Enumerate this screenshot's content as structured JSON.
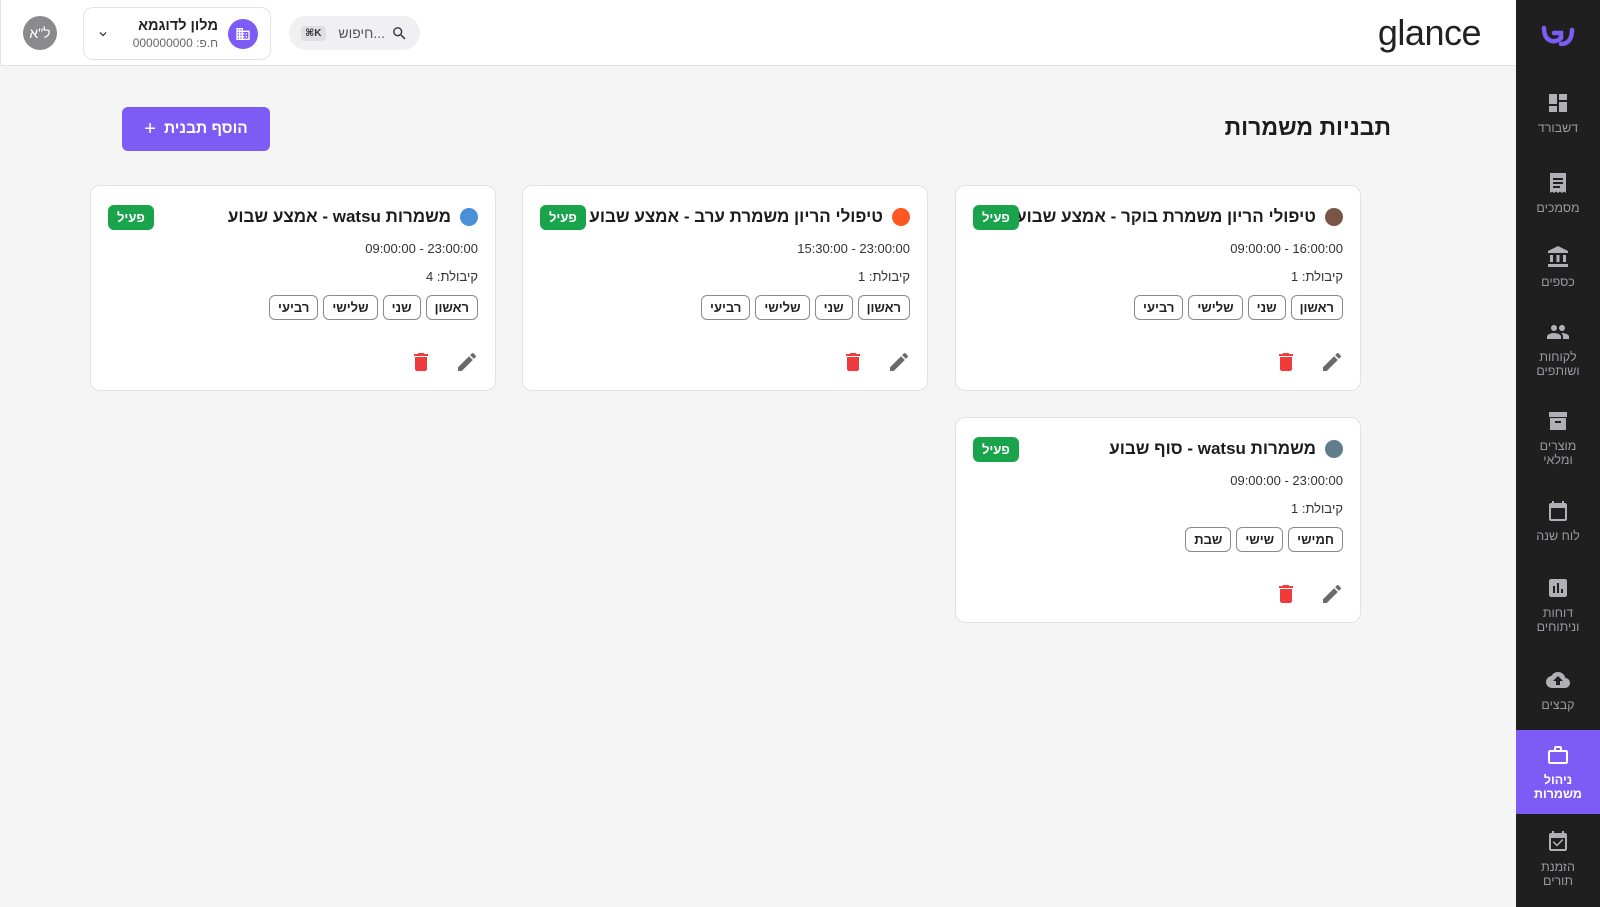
{
  "app": {
    "brand": "glance"
  },
  "header": {
    "avatar_initials": "ל\"א",
    "hotel_name": "מלון לדוגמא",
    "hotel_phone": "ח.פ: 000000000",
    "search_placeholder": "חיפוש...",
    "search_shortcut": "⌘K"
  },
  "sidebar": {
    "items": [
      {
        "label": "דשבורד",
        "icon": "dashboard-icon"
      },
      {
        "label": "מסמכים",
        "icon": "receipt-icon"
      },
      {
        "label": "כספים",
        "icon": "bank-icon"
      },
      {
        "label": "לקוחות ושותפים",
        "icon": "people-icon"
      },
      {
        "label": "מוצרים ומלאי",
        "icon": "archive-icon"
      },
      {
        "label": "לוח שנה",
        "icon": "calendar-icon"
      },
      {
        "label": "דוחות וניתוחים",
        "icon": "chart-icon"
      },
      {
        "label": "קבצים",
        "icon": "cloud-upload-icon"
      },
      {
        "label": "ניהול משמרות",
        "icon": "briefcase-icon",
        "active": true
      },
      {
        "label": "הזמנת תורים",
        "icon": "calendar-check-icon"
      }
    ]
  },
  "main": {
    "title": "תבניות משמרות",
    "add_button": "הוסף תבנית",
    "cards": [
      {
        "title": "טיפולי הריון משמרת בוקר - אמצע שבוע",
        "color": "#795548",
        "status": "פעיל",
        "time": "09:00:00 - 16:00:00",
        "capacity": "קיבולת: 1",
        "days": [
          "ראשון",
          "שני",
          "שלישי",
          "רביעי"
        ]
      },
      {
        "title": "טיפולי הריון משמרת ערב - אמצע שבוע",
        "color": "#ff5722",
        "status": "פעיל",
        "time": "15:30:00 - 23:00:00",
        "capacity": "קיבולת: 1",
        "days": [
          "ראשון",
          "שני",
          "שלישי",
          "רביעי"
        ]
      },
      {
        "title": "משמרות watsu - אמצע שבוע",
        "color": "#4a90d9",
        "status": "פעיל",
        "time": "09:00:00 - 23:00:00",
        "capacity": "קיבולת: 4",
        "days": [
          "ראשון",
          "שני",
          "שלישי",
          "רביעי"
        ]
      },
      {
        "title": "משמרות watsu - סוף שבוע",
        "color": "#607d8b",
        "status": "פעיל",
        "time": "09:00:00 - 23:00:00",
        "capacity": "קיבולת: 1",
        "days": [
          "חמישי",
          "שישי",
          "שבת"
        ]
      }
    ]
  },
  "colors": {
    "accent": "#7c5cf5",
    "active_badge": "#19a34a",
    "delete": "#ef3b3b",
    "sidebar_bg": "#1f1f1f"
  }
}
